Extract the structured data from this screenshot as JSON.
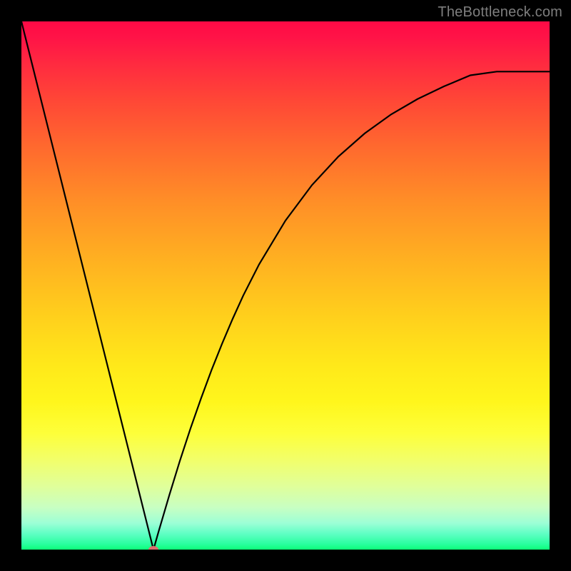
{
  "watermark": "TheBottleneck.com",
  "chart_data": {
    "type": "line",
    "title": "",
    "xlabel": "",
    "ylabel": "",
    "xlim": [
      0,
      100
    ],
    "ylim": [
      0,
      100
    ],
    "grid": false,
    "legend": false,
    "curve_description": "V-shaped bottleneck curve with steep linear left branch and asymptotic right branch",
    "marker": {
      "x": 25,
      "y": 0,
      "color": "#da6d6d"
    },
    "series": [
      {
        "name": "bottleneck-curve",
        "x": [
          0,
          2,
          4,
          6,
          8,
          10,
          12,
          14,
          16,
          18,
          20,
          22,
          24,
          25,
          26,
          28,
          30,
          32,
          34,
          36,
          38,
          40,
          42,
          45,
          50,
          55,
          60,
          65,
          70,
          75,
          80,
          85,
          90,
          95,
          100
        ],
        "y": [
          100,
          92,
          84,
          76,
          68,
          60,
          52,
          44,
          36,
          28,
          20,
          12,
          4,
          0,
          3.5,
          10.3,
          16.8,
          22.9,
          28.6,
          34.0,
          39.0,
          43.7,
          48.1,
          54.0,
          62.3,
          69.0,
          74.4,
          78.8,
          82.4,
          85.3,
          87.7,
          89.8,
          90.5,
          90.5,
          90.5
        ]
      }
    ]
  }
}
